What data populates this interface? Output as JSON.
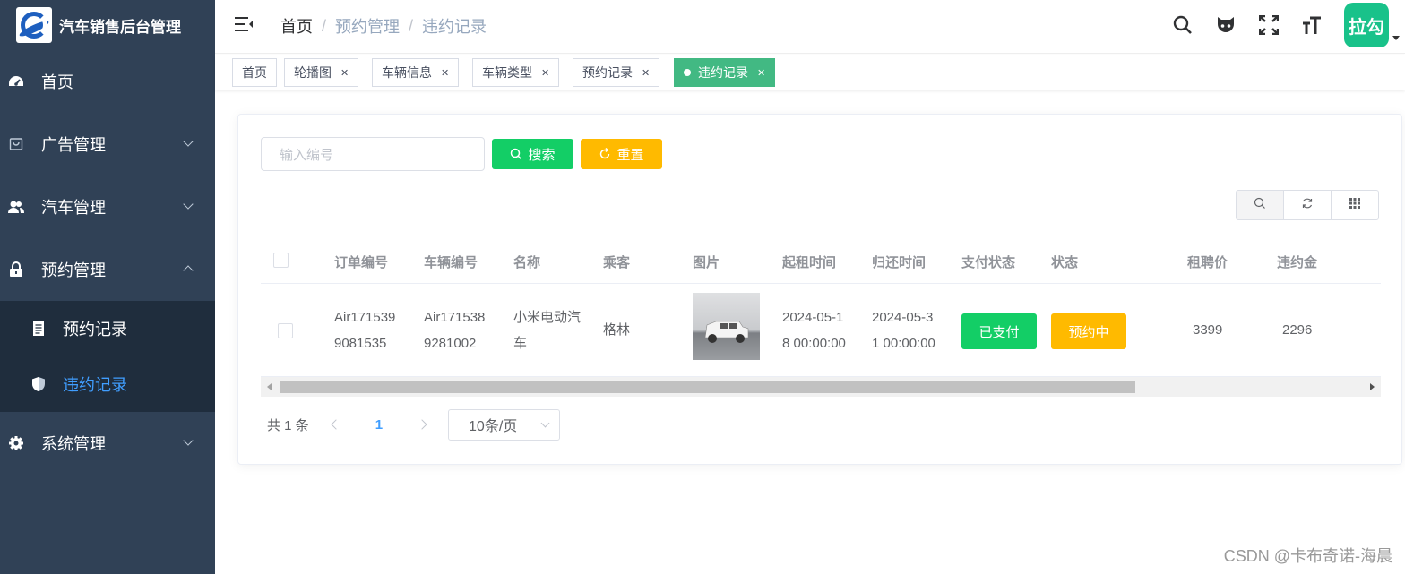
{
  "app": {
    "title": "汽车销售后台管理"
  },
  "sidebar": {
    "items": [
      {
        "label": "首页",
        "icon": "dashboard-icon"
      },
      {
        "label": "广告管理",
        "icon": "shopping-bag-icon"
      },
      {
        "label": "汽车管理",
        "icon": "users-icon"
      },
      {
        "label": "预约管理",
        "icon": "lock-icon"
      },
      {
        "label": "系统管理",
        "icon": "gear-icon"
      }
    ],
    "subitems": [
      {
        "label": "预约记录",
        "icon": "document-icon"
      },
      {
        "label": "违约记录",
        "icon": "shield-icon",
        "active": true
      }
    ]
  },
  "header": {
    "breadcrumb": [
      "首页",
      "预约管理",
      "违约记录"
    ],
    "avatar_text": "拉勾",
    "icons": [
      "search-icon",
      "github-icon",
      "fullscreen-icon",
      "font-size-icon"
    ]
  },
  "tags": [
    "首页",
    "轮播图",
    "车辆信息",
    "车辆类型",
    "预约记录",
    "违约记录"
  ],
  "filter": {
    "placeholder": "输入编号",
    "search_label": "搜索",
    "reset_label": "重置"
  },
  "table": {
    "headers": [
      "订单编号",
      "车辆编号",
      "名称",
      "乘客",
      "图片",
      "起租时间",
      "归还时间",
      "支付状态",
      "状态",
      "租聘价",
      "违约金"
    ],
    "rows": [
      {
        "order_no": [
          "Air171539",
          "9081535"
        ],
        "car_no": [
          "Air171538",
          "9281002"
        ],
        "name": [
          "小米电动汽",
          "车"
        ],
        "passenger": "格林",
        "start_time": [
          "2024-05-1",
          "8 00:00:00"
        ],
        "return_time": [
          "2024-05-3",
          "1 00:00:00"
        ],
        "pay_status": "已支付",
        "status": "预约中",
        "rent_price": "3399",
        "penalty": "2296"
      }
    ]
  },
  "pagination": {
    "total": "共 1 条",
    "current": "1",
    "page_size": "10条/页"
  },
  "colors": {
    "sidebar_bg": "#304156",
    "active_menu": "#409eff",
    "success": "#13ce66",
    "warning": "#ffba00",
    "tag_active": "#42b983",
    "avatar_bg": "#19c28a"
  },
  "watermark": "CSDN @卡布奇诺-海晨"
}
